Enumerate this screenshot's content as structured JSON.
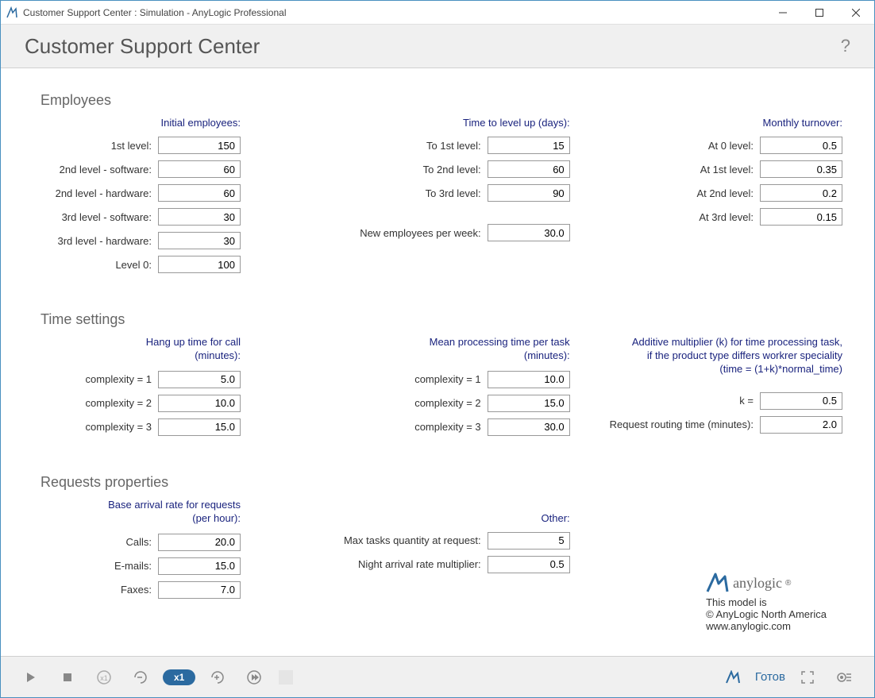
{
  "window": {
    "title": "Customer Support Center : Simulation - AnyLogic Professional"
  },
  "header": {
    "title": "Customer Support Center",
    "help": "?"
  },
  "sections": {
    "employees": "Employees",
    "time": "Time settings",
    "requests": "Requests properties"
  },
  "employees": {
    "initial": {
      "header": "Initial employees:",
      "rows": [
        {
          "label": "1st level:",
          "value": "150"
        },
        {
          "label": "2nd level - software:",
          "value": "60"
        },
        {
          "label": "2nd level - hardware:",
          "value": "60"
        },
        {
          "label": "3rd level - software:",
          "value": "30"
        },
        {
          "label": "3rd level - hardware:",
          "value": "30"
        },
        {
          "label": "Level 0:",
          "value": "100"
        }
      ]
    },
    "levelup": {
      "header": "Time to level up (days):",
      "rows": [
        {
          "label": "To 1st level:",
          "value": "15"
        },
        {
          "label": "To 2nd level:",
          "value": "60"
        },
        {
          "label": "To 3rd level:",
          "value": "90"
        }
      ],
      "newEmp": {
        "label": "New employees per week:",
        "value": "30.0"
      }
    },
    "turnover": {
      "header": "Monthly turnover:",
      "rows": [
        {
          "label": "At 0 level:",
          "value": "0.5"
        },
        {
          "label": "At 1st level:",
          "value": "0.35"
        },
        {
          "label": "At 2nd level:",
          "value": "0.2"
        },
        {
          "label": "At 3rd level:",
          "value": "0.15"
        }
      ]
    }
  },
  "time": {
    "hangup": {
      "header1": "Hang up time for call",
      "header2": "(minutes):",
      "rows": [
        {
          "label": "complexity = 1",
          "value": "5.0"
        },
        {
          "label": "complexity = 2",
          "value": "10.0"
        },
        {
          "label": "complexity = 3",
          "value": "15.0"
        }
      ]
    },
    "meanproc": {
      "header1": "Mean processing time per task",
      "header2": "(minutes):",
      "rows": [
        {
          "label": "complexity = 1",
          "value": "10.0"
        },
        {
          "label": "complexity = 2",
          "value": "15.0"
        },
        {
          "label": "complexity = 3",
          "value": "30.0"
        }
      ]
    },
    "additive": {
      "header1": "Additive multiplier (k) for time processing task,",
      "header2": "if the product type differs workrer speciality",
      "header3": "(time = (1+k)*normal_time)",
      "k": {
        "label": "k =",
        "value": "0.5"
      },
      "routing": {
        "label": "Request routing time (minutes):",
        "value": "2.0"
      }
    }
  },
  "requests": {
    "arrival": {
      "header1": "Base arrival rate for requests",
      "header2": "(per hour):",
      "rows": [
        {
          "label": "Calls:",
          "value": "20.0"
        },
        {
          "label": "E-mails:",
          "value": "15.0"
        },
        {
          "label": "Faxes:",
          "value": "7.0"
        }
      ]
    },
    "other": {
      "header": "Other:",
      "rows": [
        {
          "label": "Max tasks quantity at request:",
          "value": "5"
        },
        {
          "label": "Night arrival rate multiplier:",
          "value": "0.5"
        }
      ]
    }
  },
  "credits": {
    "line1": "This model is",
    "line2": "© AnyLogic North America",
    "line3": "www.anylogic.com",
    "brand": "anylogic"
  },
  "footer": {
    "speed": "x1",
    "status": "Готов"
  }
}
